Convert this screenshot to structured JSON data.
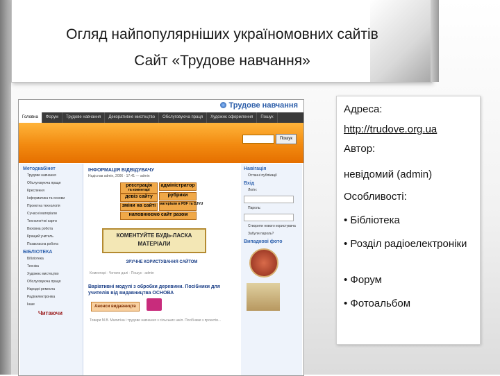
{
  "slide": {
    "title_line1": "Огляд найпопулярніших україномовних сайтів",
    "title_line2": "Сайт «Трудове навчання»"
  },
  "site": {
    "logo": "Трудове навчання",
    "nav_tabs": [
      "Головна",
      "Форум",
      "Трудове навчання",
      "Декоративне мистецтво",
      "Обслуговуюча праця",
      "Художнє оформлення",
      "Пошук"
    ],
    "search_button": "Пошук",
    "left": {
      "method_heading": "Методкабінет",
      "method_items": [
        "Трудове навчання",
        "Обслуговуюча праця",
        "Креслення",
        "Інформатика та основи",
        "Проектна технологія",
        "Сучасні матеріали",
        "Технологічні карти",
        "Виховна робота",
        "Кращий учитель",
        "Позакласна робота"
      ],
      "library_heading": "БІБЛІОТЕКА",
      "library_items": [
        "Бібліотека",
        "Техніка",
        "Художнє мистецтво",
        "Обслуговуюча праця",
        "Народні ремесла",
        "Радіоелектроніка",
        "Інше"
      ],
      "reading": "Читаючи"
    },
    "mid": {
      "heading": "ІНФОРМАЦІЯ ВІДВІДУВАЧУ",
      "sub": "Надіслав admin, 2006 · 17:41 — admin",
      "btn_register": "реєстрація",
      "btn_register_sub": "та коментарі",
      "btn_admin": "адміністратор",
      "btn_devices": "девіз сайту",
      "btn_rubrics": "рубрики",
      "btn_changes": "зміни на сайті",
      "btn_pdf": "матеріали в PDF та DJVU",
      "btn_fill": "наповнюємо сайт разом",
      "comment_text": "КОМЕНТУЙТЕ БУДЬ-ЛАСКА МАТЕРІАЛИ",
      "convenient": "ЗРУЧНЕ КОРИСТУВАННЯ САЙТОМ",
      "foot": "Коментарі · Читати далі · Пошук · admin",
      "article_title": "Варіативні модулі з обробки деревини. Посібники для учителів від видавництва ОСНОВА",
      "anons": "Анонси видавництв",
      "article_foot": "Товари М.В. Малигіна і трудове навчання з сільських шкіл. Посібники з проектів..."
    },
    "right": {
      "nav_heading": "Навігація",
      "nav_item": "Останні публікації",
      "login_heading": "Вхід",
      "login_label": "Логін:",
      "password_label": "Пароль:",
      "login_links": [
        "Створити нового користувача",
        "Забули пароль?"
      ],
      "photo_heading": "Випадкові фото"
    }
  },
  "info": {
    "address_label": "Адреса:",
    "address_value": "http://trudove.org.ua",
    "author_label": "Автор:",
    "author_value": "невідомий (admin)",
    "features_label": "Особливості:",
    "features": [
      "• Бібліотека",
      "• Розділ радіоелектроніки",
      "• Форум",
      "• Фотоальбом"
    ]
  }
}
